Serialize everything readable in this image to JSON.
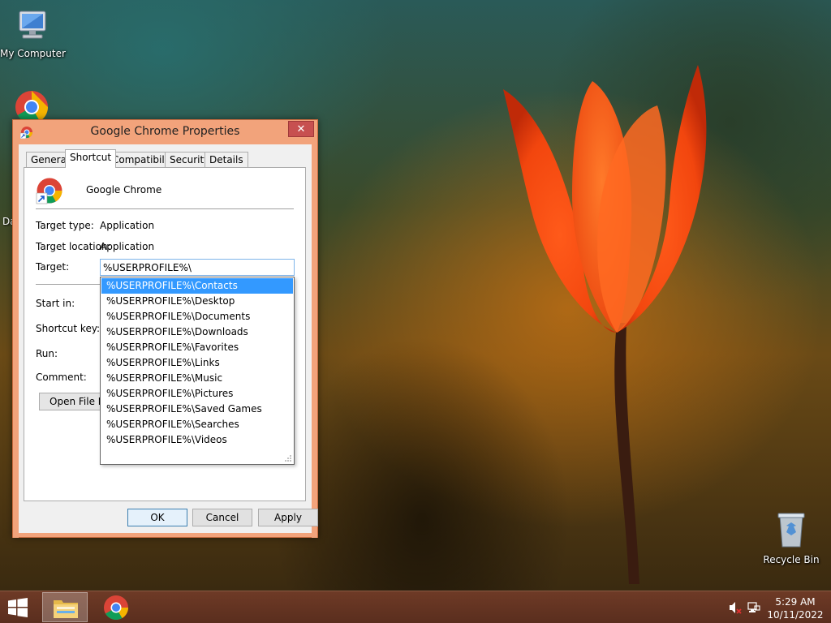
{
  "desktop": {
    "icons": {
      "my_computer": "My Computer",
      "partial_label": "Da",
      "recycle_bin": "Recycle Bin"
    }
  },
  "dialog": {
    "title": "Google Chrome Properties",
    "close_glyph": "✕",
    "tabs": [
      "General",
      "Shortcut",
      "Compatibility",
      "Security",
      "Details"
    ],
    "active_tab": "Shortcut",
    "app_name": "Google Chrome",
    "fields": {
      "target_type_label": "Target type:",
      "target_type_value": "Application",
      "target_location_label": "Target location:",
      "target_location_value": "Application",
      "target_label": "Target:",
      "target_value": "%USERPROFILE%\\",
      "start_in_label": "Start in:",
      "shortcut_key_label": "Shortcut key:",
      "run_label": "Run:",
      "comment_label": "Comment:"
    },
    "open_file_location_label": "Open File Lo",
    "buttons": {
      "ok": "OK",
      "cancel": "Cancel",
      "apply": "Apply"
    },
    "autocomplete": {
      "selected_index": 0,
      "items": [
        "%USERPROFILE%\\Contacts",
        "%USERPROFILE%\\Desktop",
        "%USERPROFILE%\\Documents",
        "%USERPROFILE%\\Downloads",
        "%USERPROFILE%\\Favorites",
        "%USERPROFILE%\\Links",
        "%USERPROFILE%\\Music",
        "%USERPROFILE%\\Pictures",
        "%USERPROFILE%\\Saved Games",
        "%USERPROFILE%\\Searches",
        "%USERPROFILE%\\Videos"
      ]
    }
  },
  "taskbar": {
    "clock_time": "5:29 AM",
    "clock_date": "10/11/2022"
  },
  "colors": {
    "titlebar": "#f2a37b",
    "selection": "#3399ff",
    "taskbar": "#5a2e1e",
    "close_button": "#c75050"
  }
}
